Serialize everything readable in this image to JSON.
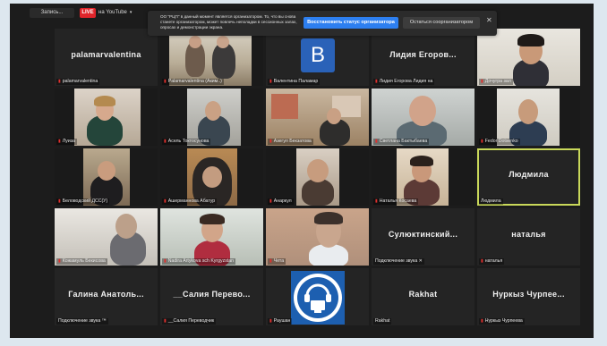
{
  "topbar": {
    "record_label": "Запись...",
    "live_badge": "LIVE",
    "live_target": "на YouTube"
  },
  "banner": {
    "message": "ОО \"РЦП\" в данный момент является организатором. То, что вы снова станете организатором, может повлечь неполадки в сессионных залах, опросах и демонстрации экрана.",
    "primary_button": "Восстановить статус организатора",
    "secondary_button": "Остаться соорганизатором"
  },
  "tiles": [
    {
      "center_name": "palamarvalentina",
      "label": "palamarvalentina",
      "muted": true
    },
    {
      "center_name": "",
      "label": "Palamarvalentina (Аким..)",
      "muted": true
    },
    {
      "center_name": "",
      "avatar_letter": "B",
      "label": "Валентина Паламар",
      "muted": true
    },
    {
      "center_name": "Лидия  Егоров...",
      "label": "Лидия Егорова Лидия на",
      "muted": true
    },
    {
      "center_name": "",
      "label": "Дочугра зал",
      "muted": true
    },
    {
      "center_name": "",
      "label": "Луиза",
      "muted": true
    },
    {
      "center_name": "",
      "label": "Асель Токтосунова",
      "muted": true
    },
    {
      "center_name": "",
      "label": "Азегул Бекзатова",
      "muted": true
    },
    {
      "center_name": "",
      "label": "Светлана Бактыбаева",
      "muted": true
    },
    {
      "center_name": "",
      "label": "Fedor Dotsenko",
      "muted": true
    },
    {
      "center_name": "",
      "label": "Беловодский ДСС(У)",
      "muted": true
    },
    {
      "center_name": "",
      "label": "Ашерманнова Абатур",
      "muted": true
    },
    {
      "center_name": "",
      "label": "Анаркул",
      "muted": true
    },
    {
      "center_name": "",
      "label": "Наталья Косаева",
      "muted": true
    },
    {
      "center_name": "Людмила",
      "label": "Людмила",
      "muted": false
    },
    {
      "center_name": "",
      "label": "Кожамуль Бекисова",
      "muted": true
    },
    {
      "center_name": "",
      "label": "Nadira Artykova sch Kyrgyzstan",
      "muted": true
    },
    {
      "center_name": "",
      "label": "Чета",
      "muted": true
    },
    {
      "center_name": "Сулюктинский...",
      "label": "Подключение звука ✕",
      "muted": false
    },
    {
      "center_name": "наталья",
      "label": "наталья",
      "muted": true
    },
    {
      "center_name": "Галина  Анатоль...",
      "label": "Подключение звука ™",
      "muted": false
    },
    {
      "center_name": "__Салия  Перево...",
      "label": "__Салия Переводчик",
      "muted": true
    },
    {
      "center_name": "",
      "label": "Раушан",
      "muted": true
    },
    {
      "center_name": "Rakhat",
      "label": "Rakhat",
      "muted": false
    },
    {
      "center_name": "Нуркыз  Чурпее...",
      "label": "Нуркыз Чурпеева",
      "muted": true
    }
  ],
  "colors": {
    "accent_blue": "#2d7ff0",
    "live_red": "#e0252b",
    "highlight": "#c9d85a"
  }
}
